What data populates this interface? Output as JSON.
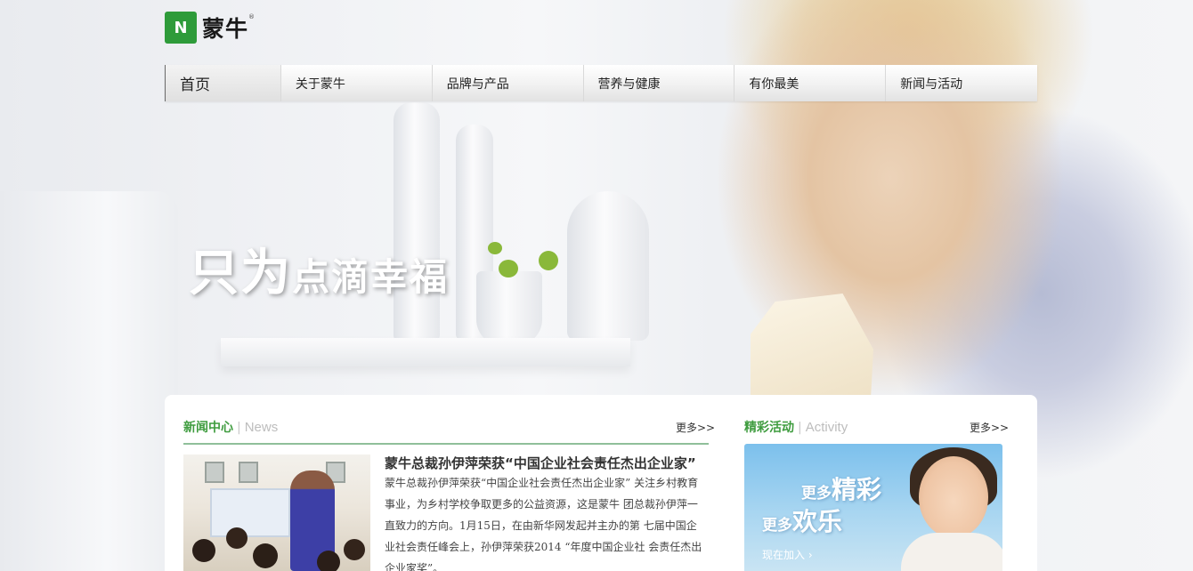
{
  "logo": {
    "mark_text": "N",
    "brand_text": "蒙牛",
    "reg_mark": "®"
  },
  "nav": {
    "items": [
      "首页",
      "关于蒙牛",
      "品牌与产品",
      "营养与健康",
      "有你最美",
      "新闻与活动"
    ]
  },
  "hero": {
    "slogan_big": "只为",
    "slogan_small": "点滴幸福"
  },
  "news": {
    "title_cn": "新闻中心",
    "divider": "|",
    "title_en": "News",
    "more": "更多>>",
    "headline": "蒙牛总裁孙伊萍荣获“中国企业社会责任杰出企业家”",
    "body": "蒙牛总裁孙伊萍荣获“中国企业社会责任杰出企业家” 关注乡村教育事业，为乡村学校争取更多的公益资源，这是蒙牛 团总裁孙伊萍一直致力的方向。1月15日，在由新华网发起并主办的第 七届中国企业社会责任峰会上，孙伊萍荣获2014 “年度中国企业社 会责任杰出企业家奖”。"
  },
  "activity": {
    "title_cn": "精彩活动",
    "divider": "|",
    "title_en": "Activity",
    "more": "更多>>",
    "banner_line1_small": "更多",
    "banner_line1_large": "精彩",
    "banner_line2_small": "更多",
    "banner_line2_large": "欢乐",
    "banner_join": "现在加入 ›"
  }
}
